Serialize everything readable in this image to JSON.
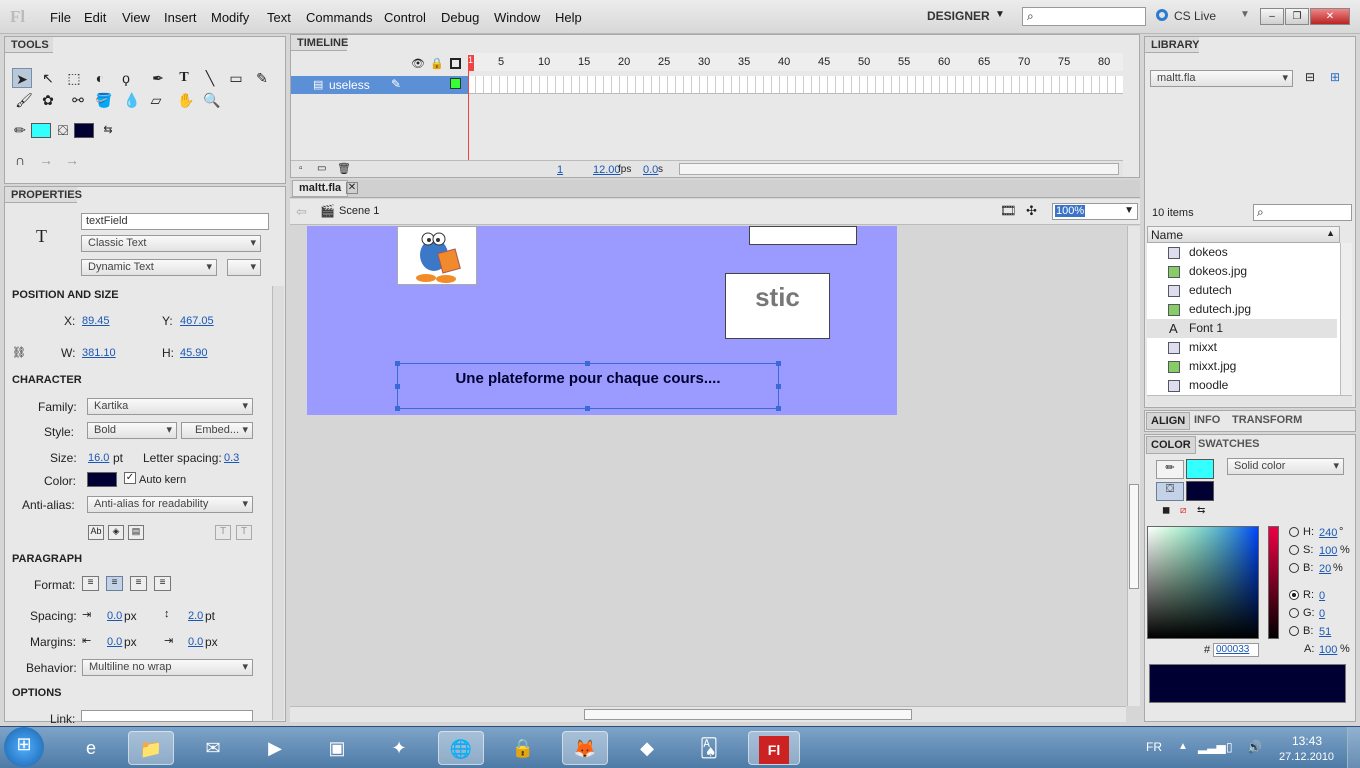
{
  "app": {
    "logo": "Fl",
    "workspace": "DESIGNER",
    "cslive": "CS Live",
    "minimize": "–",
    "restore": "❐",
    "close": "✕"
  },
  "menu": [
    "File",
    "Edit",
    "View",
    "Insert",
    "Modify",
    "Text",
    "Commands",
    "Control",
    "Debug",
    "Window",
    "Help"
  ],
  "panels": {
    "tools": "TOOLS",
    "timeline": "TIMELINE",
    "properties": "PROPERTIES",
    "library": "LIBRARY"
  },
  "timeline": {
    "layer": "useless",
    "frames": [
      "1",
      "5",
      "10",
      "15",
      "20",
      "25",
      "30",
      "35",
      "40",
      "45",
      "50",
      "55",
      "60",
      "65",
      "70",
      "75",
      "80"
    ],
    "current_frame": "1",
    "fps": "12.00",
    "fps_unit": "fps",
    "time": "0.0",
    "time_unit": "s"
  },
  "doc": {
    "tab": "maltt.fla",
    "scene": "Scene 1",
    "zoom": "100%"
  },
  "stage": {
    "box_text": "stic",
    "text_field": "Une plateforme pour chaque cours...."
  },
  "properties": {
    "instance_name": "textField",
    "text_engine": "Classic Text",
    "text_type": "Dynamic Text",
    "pos_header": "POSITION AND SIZE",
    "x_label": "X:",
    "x": "89.45",
    "y_label": "Y:",
    "y": "467.05",
    "w_label": "W:",
    "w": "381.10",
    "h_label": "H:",
    "h": "45.90",
    "char_header": "CHARACTER",
    "family_label": "Family:",
    "family": "Kartika",
    "style_label": "Style:",
    "style": "Bold",
    "embed": "Embed...",
    "size_label": "Size:",
    "size": "16.0",
    "size_unit": "pt",
    "letter_label": "Letter spacing:",
    "letter": "0.3",
    "color_label": "Color:",
    "autokern": "Auto kern",
    "antialias_label": "Anti-alias:",
    "antialias": "Anti-alias for readability",
    "para_header": "PARAGRAPH",
    "format_label": "Format:",
    "spacing_label": "Spacing:",
    "spacing1": "0.0",
    "spacing1_unit": "px",
    "spacing2": "2.0",
    "spacing2_unit": "pt",
    "margins_label": "Margins:",
    "margin1": "0.0",
    "margin1_unit": "px",
    "margin2": "0.0",
    "margin2_unit": "px",
    "behavior_label": "Behavior:",
    "behavior": "Multiline no wrap",
    "options_header": "OPTIONS",
    "link_label": "Link:"
  },
  "library": {
    "file": "maltt.fla",
    "count": "10 items",
    "name_header": "Name",
    "items": [
      "dokeos",
      "dokeos.jpg",
      "edutech",
      "edutech.jpg",
      "Font 1",
      "mixxt",
      "mixxt.jpg",
      "moodle"
    ]
  },
  "align_tabs": [
    "ALIGN",
    "INFO",
    "TRANSFORM"
  ],
  "color_tabs": [
    "COLOR",
    "SWATCHES"
  ],
  "color": {
    "mode": "Solid color",
    "h_label": "H:",
    "h": "240",
    "h_unit": "°",
    "s_label": "S:",
    "s": "100",
    "s_unit": "%",
    "b_label": "B:",
    "b": "20",
    "b_unit": "%",
    "r_label": "R:",
    "r": "0",
    "g_label": "G:",
    "g": "0",
    "bl_label": "B:",
    "bl": "51",
    "hash": "#",
    "hex": "000033",
    "a_label": "A:",
    "a": "100",
    "a_unit": "%",
    "stroke": "#33ffff",
    "fill": "#000033"
  },
  "taskbar": {
    "lang": "FR",
    "time": "13:43",
    "date": "27.12.2010"
  }
}
